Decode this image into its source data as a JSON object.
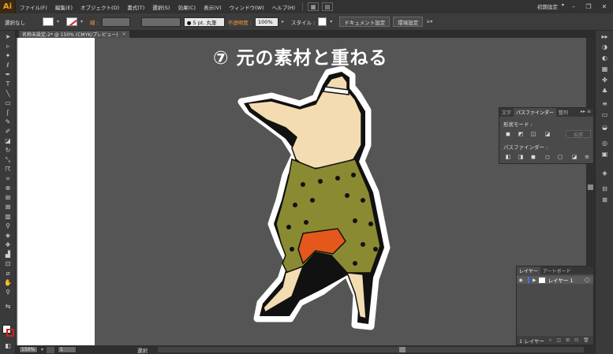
{
  "app": {
    "logo": "Ai",
    "menus": [
      "ファイル(F)",
      "編集(E)",
      "オブジェクト(O)",
      "書式(T)",
      "選択(S)",
      "効果(C)",
      "表示(V)",
      "ウィンドウ(W)",
      "ヘルプ(H)"
    ],
    "workspace": "初期設定",
    "workspace_arrow": "▾",
    "window_controls": {
      "minimize": "–",
      "restore": "❐",
      "close": "✕"
    }
  },
  "control_bar": {
    "selection": "選択なし",
    "stroke_label": "線 :",
    "brush": "● 5 pt. 丸筆",
    "opacity_label": "不透明度 :",
    "opacity_value": "100%",
    "style_label": "スタイル :",
    "doc_setup_button": "ドキュメント設定",
    "prefs_button": "環境設定"
  },
  "document_tab": {
    "title": "名称未設定-2* @ 150% (CMYK/プレビュー)",
    "close": "×"
  },
  "canvas": {
    "title": "⑦ 元の素材と重ねる"
  },
  "pathfinder_panel": {
    "tabs": [
      "文字",
      "パスファインダー",
      "整列"
    ],
    "active_tab": "パスファインダー",
    "menu_icon": "▸▸ ≡",
    "shape_mode_label": "形状モード :",
    "pathfinder_label": "パスファインダー :",
    "expand_button": "拡張"
  },
  "layers_panel": {
    "tabs": [
      "レイヤー",
      "アートボード"
    ],
    "active_tab": "レイヤー",
    "layer_name": "レイヤー 1",
    "eye": "◉",
    "expand_arrow": "▶",
    "target": "○",
    "footer_count": "1 レイヤー"
  },
  "status_bar": {
    "zoom": "150%",
    "page": "1",
    "status": "選択"
  },
  "colors": {
    "menubar_bg": "#323232",
    "canvas_bg": "#555555",
    "accent_orange": "#f7a21b",
    "layer_color": "#4a6cff",
    "loincloth_orange": "#e5581c",
    "kimono_olive": "#8a8a32",
    "skin": "#f3dcb2"
  }
}
